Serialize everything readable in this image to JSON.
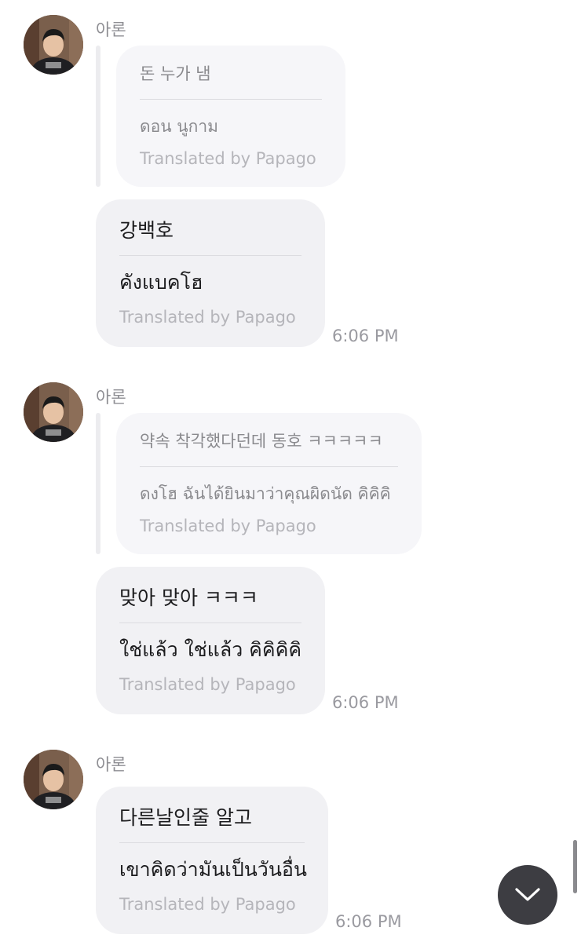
{
  "messages": [
    {
      "sender": "아론",
      "quote": {
        "original": "돈 누가 냄",
        "translation": "ดอน นูกาม",
        "credit": "Translated by Papago"
      },
      "bubble": {
        "original": "강백호",
        "translation": "คังแบคโฮ",
        "credit": "Translated by Papago"
      },
      "time": "6:06 PM"
    },
    {
      "sender": "아론",
      "quote": {
        "original": "약속 착각했다던데 동호 ㅋㅋㅋㅋㅋ",
        "translation": "ดงโฮ ฉันได้ยินมาว่าคุณผิดนัด คิคิคิ",
        "credit": "Translated by Papago"
      },
      "bubble": {
        "original": "맞아 맞아 ㅋㅋㅋ",
        "translation": "ใช่แล้ว ใช่แล้ว คิคิคิคิ",
        "credit": "Translated by Papago"
      },
      "time": "6:06 PM"
    },
    {
      "sender": "아론",
      "bubble": {
        "original": "다른날인줄 알고",
        "translation": "เขาคิดว่ามันเป็นวันอื่น",
        "credit": "Translated by Papago"
      },
      "time": "6:06 PM"
    }
  ],
  "colors": {
    "bubble": "#f1f1f4",
    "quote_bubble": "#f6f6f9",
    "scroll_button": "#3d3d42"
  },
  "icons": {
    "scroll_button": "chevron-down-icon"
  }
}
